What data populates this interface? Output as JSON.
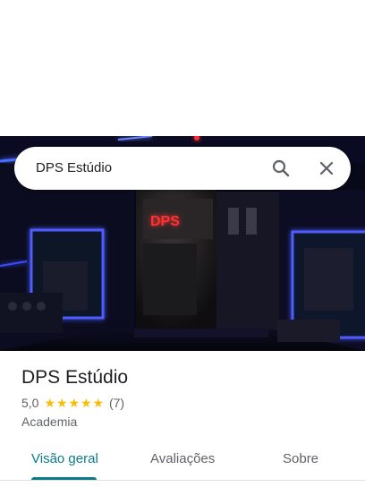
{
  "search": {
    "query": "DPS Estúdio",
    "search_icon": "search-icon",
    "close_icon": "close-icon"
  },
  "hero": {
    "sign_text": "DPS",
    "accent_color": "#3b5bff",
    "sign_color": "#ff3b3b"
  },
  "place": {
    "name": "DPS Estúdio",
    "rating_value": "5,0",
    "stars": 5,
    "reviews_count": "(7)",
    "category": "Academia"
  },
  "tabs": [
    {
      "label": "Visão geral",
      "active": true
    },
    {
      "label": "Avaliações",
      "active": false
    },
    {
      "label": "Sobre",
      "active": false
    }
  ],
  "colors": {
    "star": "#fbbc04",
    "active_tab": "#0b7b8b"
  }
}
